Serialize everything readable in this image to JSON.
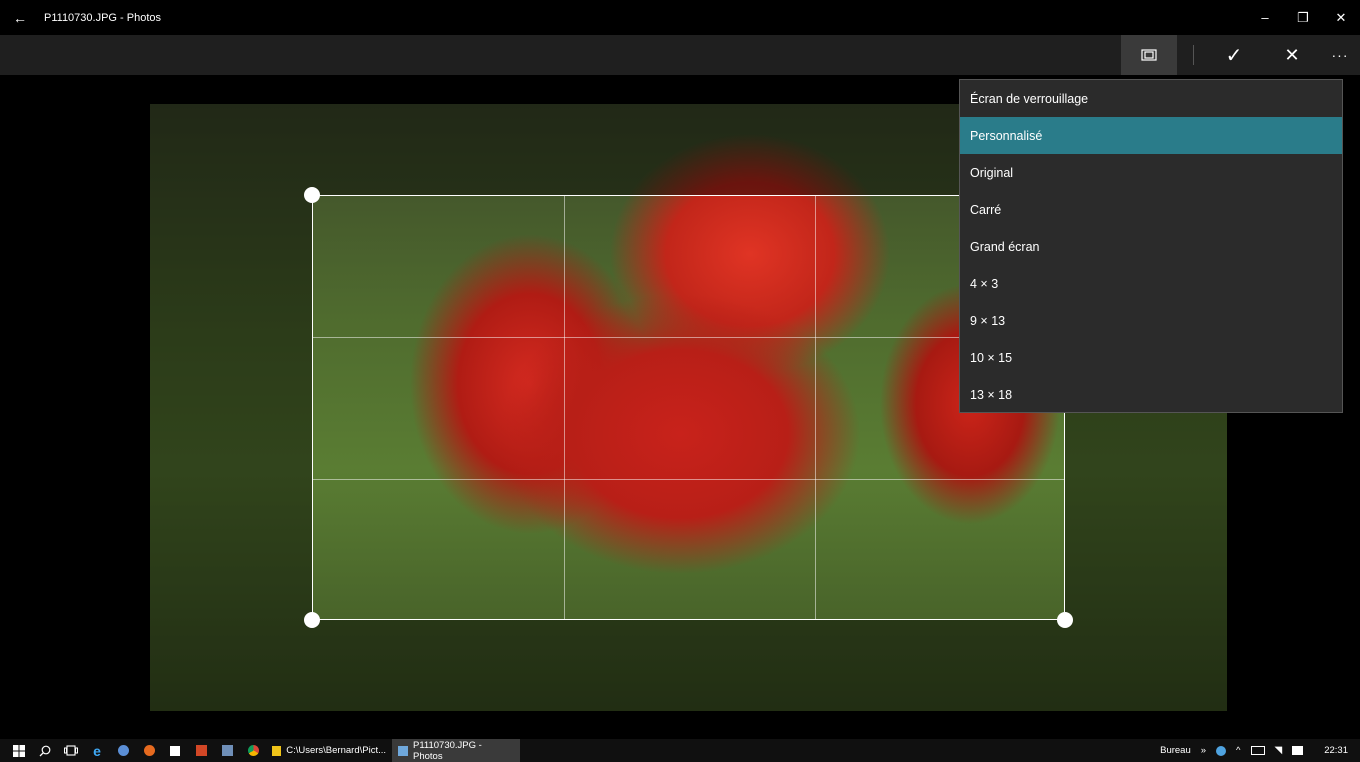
{
  "window": {
    "back_glyph": "←",
    "title": "P1110730.JPG - Photos",
    "minimize_glyph": "–",
    "restore_glyph": "❐",
    "close_glyph": "✕"
  },
  "toolbar": {
    "aspect_icon": "aspect-ratio-icon",
    "check_glyph": "✓",
    "cancel_glyph": "✕",
    "more_glyph": "···"
  },
  "aspect_menu": {
    "selected_index": 1,
    "items": [
      "Écran de verrouillage",
      "Personnalisé",
      "Original",
      "Carré",
      "Grand écran",
      "4 × 3",
      "9 × 13",
      "10 × 15",
      "13 × 18"
    ]
  },
  "taskbar": {
    "tasks": [
      {
        "label": "C:\\Users\\Bernard\\Pict...",
        "color": "#f0c419"
      },
      {
        "label": "P1110730.JPG - Photos",
        "color": "#6fa8dc"
      }
    ],
    "tray": {
      "desktop_label": "Bureau",
      "overflow_glyph": "»",
      "chevron_glyph": "^",
      "time": "22:31"
    }
  },
  "colors": {
    "menu_selected": "#2a7c8a",
    "toolbar_bg": "#1f1f1f",
    "menu_bg": "#2b2b2b"
  }
}
